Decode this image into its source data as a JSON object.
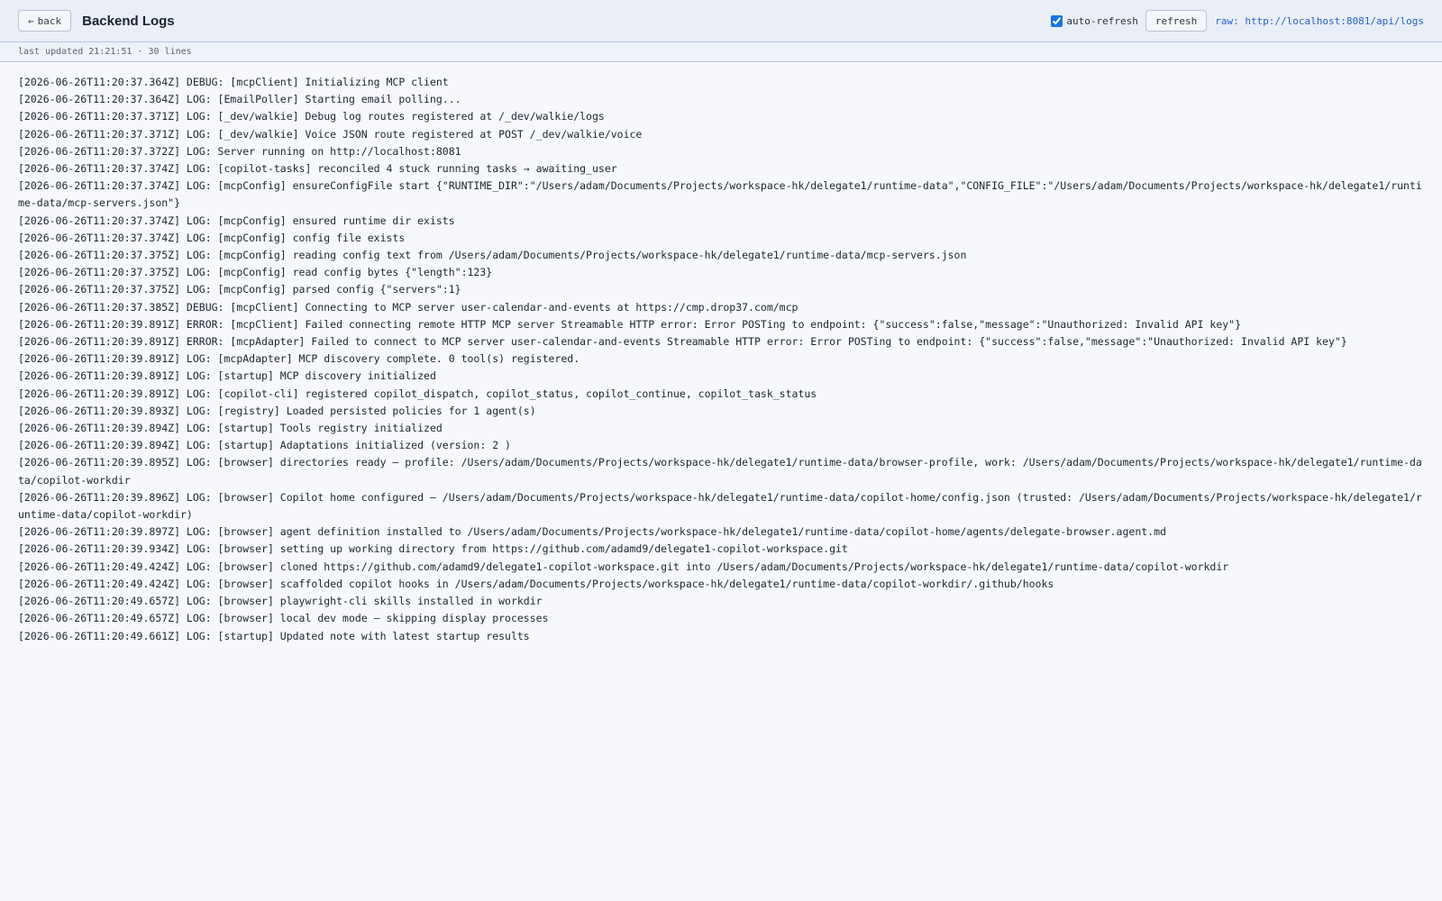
{
  "header": {
    "back_label": "back",
    "back_icon": "left-arrow-icon",
    "title": "Backend Logs",
    "auto_refresh_label": "auto-refresh",
    "auto_refresh_checked": true,
    "refresh_label": "refresh",
    "raw_link": "raw: http://localhost:8081/api/logs"
  },
  "status": {
    "last_updated": "last updated 21:21:51",
    "line_count": "30 lines"
  },
  "logs": [
    "[2026-06-26T11:20:37.364Z] DEBUG: [mcpClient] Initializing MCP client",
    "[2026-06-26T11:20:37.364Z] LOG: [EmailPoller] Starting email polling...",
    "[2026-06-26T11:20:37.371Z] LOG: [_dev/walkie] Debug log routes registered at /_dev/walkie/logs",
    "[2026-06-26T11:20:37.371Z] LOG: [_dev/walkie] Voice JSON route registered at POST /_dev/walkie/voice",
    "[2026-06-26T11:20:37.372Z] LOG: Server running on http://localhost:8081",
    "[2026-06-26T11:20:37.374Z] LOG: [copilot-tasks] reconciled 4 stuck running tasks → awaiting_user",
    "[2026-06-26T11:20:37.374Z] LOG: [mcpConfig] ensureConfigFile start {\"RUNTIME_DIR\":\"/Users/adam/Documents/Projects/workspace-hk/delegate1/runtime-data\",\"CONFIG_FILE\":\"/Users/adam/Documents/Projects/workspace-hk/delegate1/runtime-data/mcp-servers.json\"}",
    "[2026-06-26T11:20:37.374Z] LOG: [mcpConfig] ensured runtime dir exists",
    "[2026-06-26T11:20:37.374Z] LOG: [mcpConfig] config file exists",
    "[2026-06-26T11:20:37.375Z] LOG: [mcpConfig] reading config text from /Users/adam/Documents/Projects/workspace-hk/delegate1/runtime-data/mcp-servers.json",
    "[2026-06-26T11:20:37.375Z] LOG: [mcpConfig] read config bytes {\"length\":123}",
    "[2026-06-26T11:20:37.375Z] LOG: [mcpConfig] parsed config {\"servers\":1}",
    "[2026-06-26T11:20:37.385Z] DEBUG: [mcpClient] Connecting to MCP server user-calendar-and-events at https://cmp.drop37.com/mcp",
    "[2026-06-26T11:20:39.891Z] ERROR: [mcpClient] Failed connecting remote HTTP MCP server Streamable HTTP error: Error POSTing to endpoint: {\"success\":false,\"message\":\"Unauthorized: Invalid API key\"}",
    "[2026-06-26T11:20:39.891Z] ERROR: [mcpAdapter] Failed to connect to MCP server user-calendar-and-events Streamable HTTP error: Error POSTing to endpoint: {\"success\":false,\"message\":\"Unauthorized: Invalid API key\"}",
    "[2026-06-26T11:20:39.891Z] LOG: [mcpAdapter] MCP discovery complete. 0 tool(s) registered.",
    "[2026-06-26T11:20:39.891Z] LOG: [startup] MCP discovery initialized",
    "[2026-06-26T11:20:39.891Z] LOG: [copilot-cli] registered copilot_dispatch, copilot_status, copilot_continue, copilot_task_status",
    "[2026-06-26T11:20:39.893Z] LOG: [registry] Loaded persisted policies for 1 agent(s)",
    "[2026-06-26T11:20:39.894Z] LOG: [startup] Tools registry initialized",
    "[2026-06-26T11:20:39.894Z] LOG: [startup] Adaptations initialized (version: 2 )",
    "[2026-06-26T11:20:39.895Z] LOG: [browser] directories ready — profile: /Users/adam/Documents/Projects/workspace-hk/delegate1/runtime-data/browser-profile, work: /Users/adam/Documents/Projects/workspace-hk/delegate1/runtime-data/copilot-workdir",
    "[2026-06-26T11:20:39.896Z] LOG: [browser] Copilot home configured — /Users/adam/Documents/Projects/workspace-hk/delegate1/runtime-data/copilot-home/config.json (trusted: /Users/adam/Documents/Projects/workspace-hk/delegate1/runtime-data/copilot-workdir)",
    "[2026-06-26T11:20:39.897Z] LOG: [browser] agent definition installed to /Users/adam/Documents/Projects/workspace-hk/delegate1/runtime-data/copilot-home/agents/delegate-browser.agent.md",
    "[2026-06-26T11:20:39.934Z] LOG: [browser] setting up working directory from https://github.com/adamd9/delegate1-copilot-workspace.git",
    "[2026-06-26T11:20:49.424Z] LOG: [browser] cloned https://github.com/adamd9/delegate1-copilot-workspace.git into /Users/adam/Documents/Projects/workspace-hk/delegate1/runtime-data/copilot-workdir",
    "[2026-06-26T11:20:49.424Z] LOG: [browser] scaffolded copilot hooks in /Users/adam/Documents/Projects/workspace-hk/delegate1/runtime-data/copilot-workdir/.github/hooks",
    "[2026-06-26T11:20:49.657Z] LOG: [browser] playwright-cli skills installed in workdir",
    "[2026-06-26T11:20:49.657Z] LOG: [browser] local dev mode — skipping display processes",
    "[2026-06-26T11:20:49.661Z] LOG: [startup] Updated note with latest startup results"
  ]
}
